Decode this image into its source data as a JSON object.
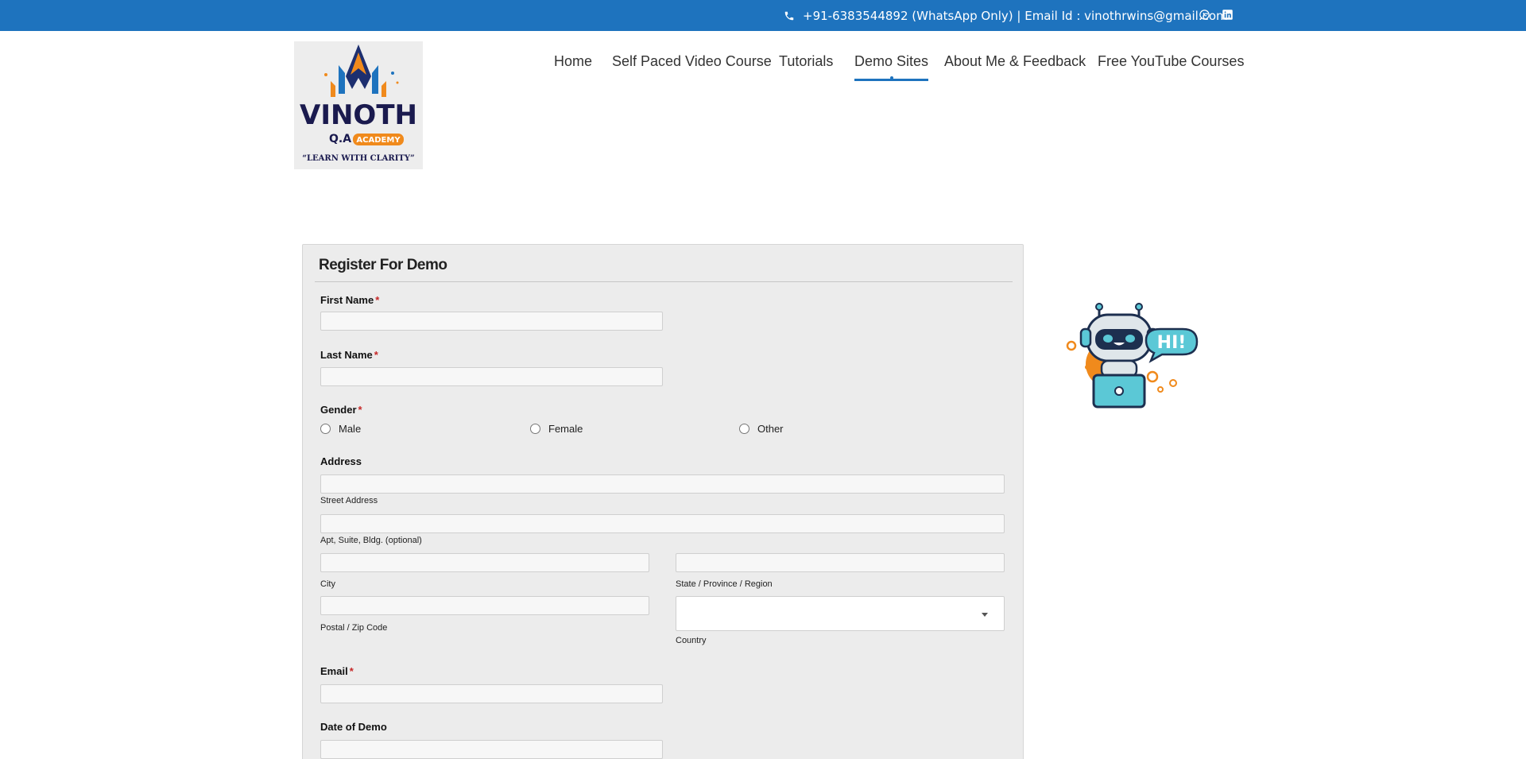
{
  "topbar": {
    "contact_text": "+91-6383544892 (WhatsApp Only) | Email Id : vinothrwins@gmail.com",
    "phone_icon": "phone-icon",
    "social_icons": [
      "whatsapp-icon",
      "linkedin-icon"
    ],
    "bg_color": "#1e73be"
  },
  "logo": {
    "brand": "VINOTH",
    "line2_left": "Q.A",
    "line2_right": "ACADEMY",
    "tagline": "“LEARN WITH CLARITY”"
  },
  "nav": {
    "items": [
      {
        "label": "Home",
        "active": false
      },
      {
        "label": "Self Paced Video Course",
        "active": false
      },
      {
        "label": "Tutorials",
        "active": false
      },
      {
        "label": "Demo Sites",
        "active": true
      },
      {
        "label": "About Me & Feedback",
        "active": false
      },
      {
        "label": "Free YouTube Courses",
        "active": false
      }
    ]
  },
  "form": {
    "title": "Register For Demo",
    "required_marker": "*",
    "first_name_label": "First Name",
    "last_name_label": "Last Name",
    "gender_label": "Gender",
    "gender_options": [
      "Male",
      "Female",
      "Other"
    ],
    "address_label": "Address",
    "street_sub": "Street Address",
    "apt_sub": "Apt, Suite, Bldg. (optional)",
    "city_sub": "City",
    "state_sub": "State / Province / Region",
    "postal_sub": "Postal / Zip Code",
    "country_sub": "Country",
    "country_value": "",
    "email_label": "Email",
    "date_label": "Date of Demo"
  },
  "robot": {
    "bubble_text": "HI!"
  }
}
